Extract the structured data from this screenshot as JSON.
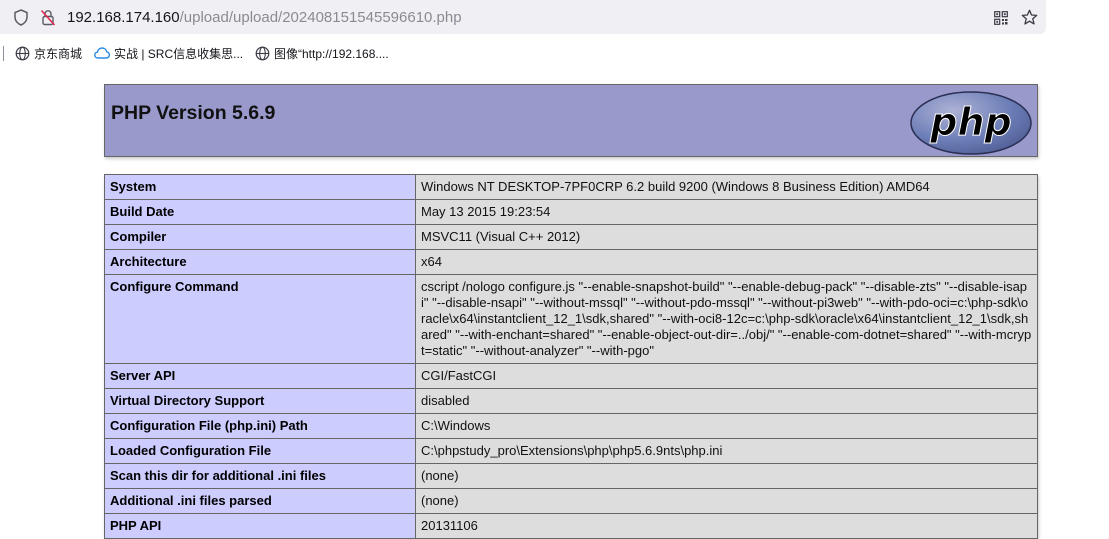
{
  "browser": {
    "url_host": "192.168.174.160",
    "url_path": "/upload/upload/202408151545596610.php",
    "bookmarks": [
      {
        "label": "京东商城",
        "icon": "globe-icon"
      },
      {
        "label": "实战 | SRC信息收集思...",
        "icon": "cloud-icon"
      },
      {
        "label": "图像“http://192.168....",
        "icon": "globe-icon"
      }
    ]
  },
  "php": {
    "title": "PHP Version 5.6.9",
    "logo_text": "php",
    "rows": [
      {
        "key": "System",
        "value": "Windows NT DESKTOP-7PF0CRP 6.2 build 9200 (Windows 8 Business Edition) AMD64"
      },
      {
        "key": "Build Date",
        "value": "May 13 2015 19:23:54"
      },
      {
        "key": "Compiler",
        "value": "MSVC11 (Visual C++ 2012)"
      },
      {
        "key": "Architecture",
        "value": "x64"
      },
      {
        "key": "Configure Command",
        "value": "cscript /nologo configure.js \"--enable-snapshot-build\" \"--enable-debug-pack\" \"--disable-zts\" \"--disable-isapi\" \"--disable-nsapi\" \"--without-mssql\" \"--without-pdo-mssql\" \"--without-pi3web\" \"--with-pdo-oci=c:\\php-sdk\\oracle\\x64\\instantclient_12_1\\sdk,shared\" \"--with-oci8-12c=c:\\php-sdk\\oracle\\x64\\instantclient_12_1\\sdk,shared\" \"--with-enchant=shared\" \"--enable-object-out-dir=../obj/\" \"--enable-com-dotnet=shared\" \"--with-mcrypt=static\" \"--without-analyzer\" \"--with-pgo\""
      },
      {
        "key": "Server API",
        "value": "CGI/FastCGI"
      },
      {
        "key": "Virtual Directory Support",
        "value": "disabled"
      },
      {
        "key": "Configuration File (php.ini) Path",
        "value": "C:\\Windows"
      },
      {
        "key": "Loaded Configuration File",
        "value": "C:\\phpstudy_pro\\Extensions\\php\\php5.6.9nts\\php.ini"
      },
      {
        "key": "Scan this dir for additional .ini files",
        "value": "(none)"
      },
      {
        "key": "Additional .ini files parsed",
        "value": "(none)"
      },
      {
        "key": "PHP API",
        "value": "20131106"
      }
    ]
  },
  "colors": {
    "header_bg": "#9999cc",
    "key_bg": "#ccccff",
    "value_bg": "#dddddd"
  }
}
